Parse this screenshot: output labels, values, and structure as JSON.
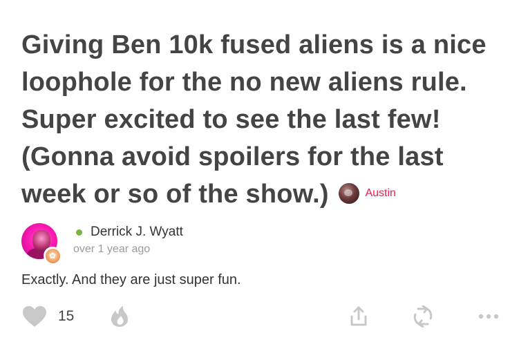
{
  "post": {
    "quote_text": "Giving Ben 10k fused aliens is a nice loophole for the no new aliens rule. Super excited to see the last few! (Gonna avoid spoilers for the last week or so of the show.)",
    "quote_author": "Austin",
    "author_color": "#e8204f"
  },
  "reply": {
    "username": "Derrick J. Wyatt",
    "online_status_color": "#7cb342",
    "timestamp": "over 1 year ago",
    "text": "Exactly. And they are just super fun."
  },
  "actions": {
    "like_icon": "heart-icon",
    "like_count": "15",
    "fire_icon": "flame-icon",
    "share_icon": "share-icon",
    "repost_icon": "repost-icon",
    "more_icon": "ellipsis-icon",
    "icon_color": "#c8c8c8"
  }
}
